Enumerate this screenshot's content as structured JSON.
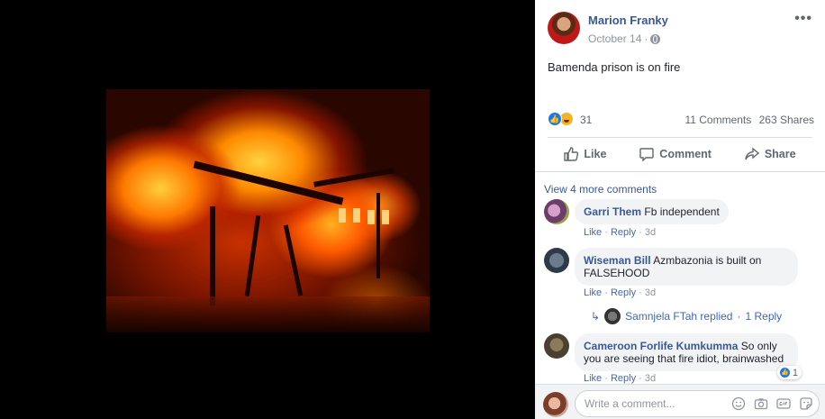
{
  "post": {
    "author": "Marion Franky",
    "date": "October 14",
    "date_sep": "·",
    "text": "Bamenda prison is on fire",
    "reaction_count": "31",
    "comments_count": "11 Comments",
    "shares_count": "263 Shares"
  },
  "actions": {
    "like": "Like",
    "comment": "Comment",
    "share": "Share"
  },
  "comments_section": {
    "view_more": "View 4 more comments",
    "items": [
      {
        "name": "Garri Them",
        "text": "Fb independent",
        "like": "Like",
        "reply": "Reply",
        "sep": "·",
        "time": "3d"
      },
      {
        "name": "Wiseman Bill",
        "text_line1": "Azmbazonia is built on",
        "text_line2": "FALSEHOOD",
        "like": "Like",
        "reply": "Reply",
        "sep": "·",
        "time": "3d"
      },
      {
        "name": "Cameroon Forlife Kumkumma",
        "text_line1": "So only",
        "text_line2": "you are seeing that fire idiot, brainwashed",
        "like": "Like",
        "reply": "Reply",
        "sep": "·",
        "time": "3d",
        "reaction_count": "1"
      }
    ],
    "reply_summary": {
      "author_text": "Samnjela FTah replied",
      "sep": "·",
      "count_text": "1 Reply"
    }
  },
  "compose": {
    "placeholder": "Write a comment..."
  },
  "colors": {
    "link": "#385898",
    "accent": "#1877f2",
    "meta": "#90949c"
  }
}
